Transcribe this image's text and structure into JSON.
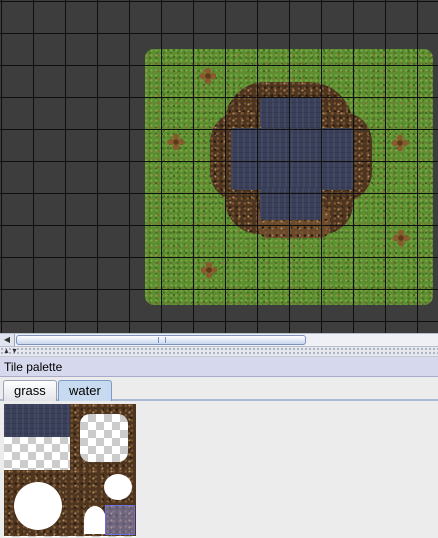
{
  "palette": {
    "title": "Tile palette",
    "tabs": [
      {
        "label": "grass",
        "selected": false
      },
      {
        "label": "water",
        "selected": true
      }
    ]
  },
  "scrollbar": {
    "left_arrow_icon": "arrow-left-icon",
    "grip_icon": "grip-icon"
  },
  "divider": {
    "icons": [
      "arrow-up-icon",
      "arrow-down-icon"
    ]
  },
  "colors": {
    "map_background": "#3d3d3d",
    "grid_lines": "#101010",
    "grass": "#5d8f31",
    "water": "#3a3f5a",
    "dirt": "#4e3520",
    "tab_selected": "#c8daf0",
    "title_bar": "#d6d8ee",
    "tile_selection": "#6a70d8"
  }
}
